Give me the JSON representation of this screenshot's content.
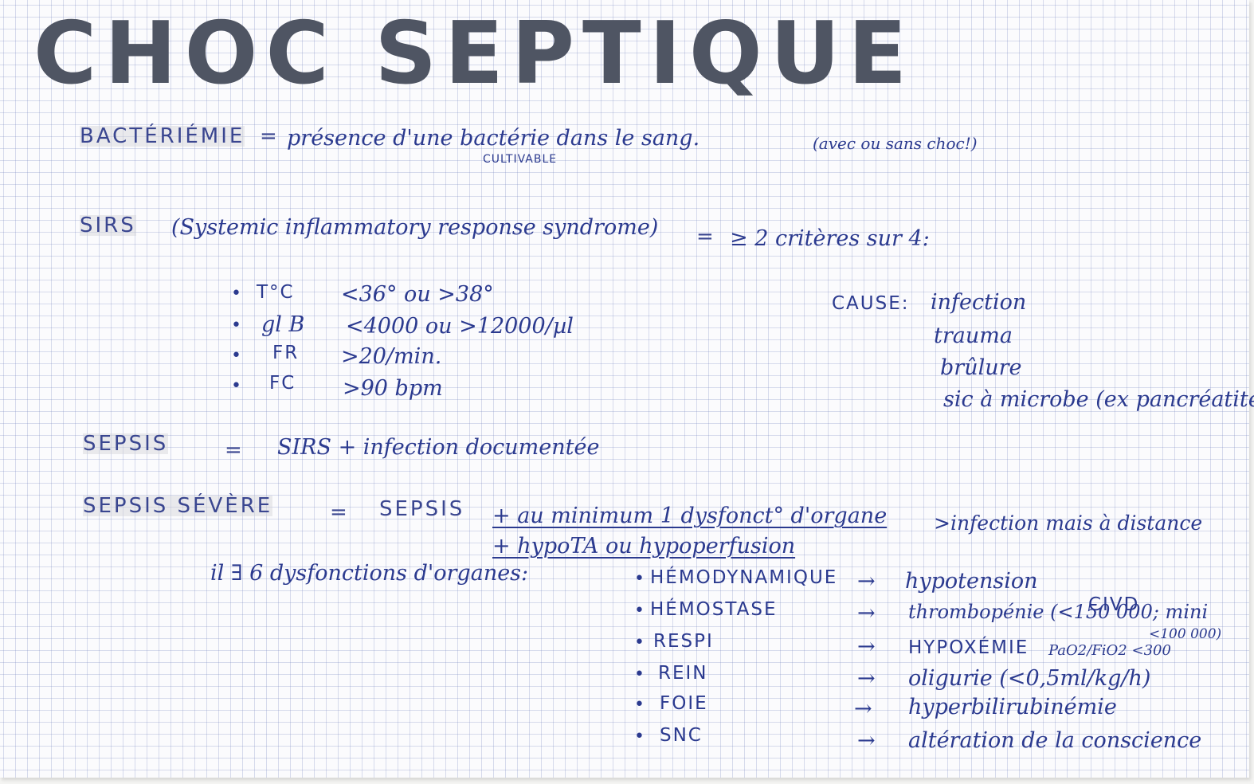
{
  "title": "CHOC SEPTIQUE",
  "bacteriemie": {
    "term": "BACTÉRIÉMIE",
    "eq": "=",
    "def": "présence d'une bactérie dans le sang.",
    "note": "(avec ou sans choc!)",
    "annotation": "CULTIVABLE"
  },
  "sirs": {
    "term": "SIRS",
    "expansion": "(Systemic inflammatory response syndrome)",
    "eq": "=",
    "criteria_intro": "≥ 2 critères sur 4:",
    "criteria": [
      {
        "bullet": "•",
        "name": "T°C",
        "value": "<36°  ou  >38°"
      },
      {
        "bullet": "•",
        "name": "gl B",
        "value": "<4000  ou  >12000/µl"
      },
      {
        "bullet": "•",
        "name": "FR",
        "value": ">20/min."
      },
      {
        "bullet": "•",
        "name": "FC",
        "value": ">90 bpm"
      }
    ],
    "cause_label": "CAUSE:",
    "causes": [
      "infection",
      "trauma",
      "brûlure",
      "sic à microbe (ex pancréatite)"
    ]
  },
  "sepsis": {
    "term": "SEPSIS",
    "eq": "=",
    "def": "SIRS + infection documentée"
  },
  "sepsis_severe": {
    "term": "SEPSIS  SÉVÈRE",
    "eq": "=",
    "base": "SEPSIS",
    "line1": "+ au minimum 1 dysfonct° d'organe",
    "line1_note": ">infection mais à distance",
    "line2": "+ hypoTA ou hypoperfusion"
  },
  "dysfunctions": {
    "intro": "il ∃  6 dysfonctions d'organes:",
    "items": [
      {
        "bullet": "•",
        "organ": "HÉMODYNAMIQUE",
        "arrow": "→",
        "result": "hypotension",
        "extra": ""
      },
      {
        "bullet": "•",
        "organ": "HÉMOSTASE",
        "arrow": "→",
        "result": "thrombopénie (<150 000; mini",
        "extra": "<100 000)"
      },
      {
        "bullet": "•",
        "organ": "RESPI",
        "arrow": "→",
        "result": "HYPOXÉMIE",
        "extra": "PaO2/FiO2 <300"
      },
      {
        "bullet": "•",
        "organ": "REIN",
        "arrow": "→",
        "result": "oligurie (<0,5ml/kg/h)",
        "extra": ""
      },
      {
        "bullet": "•",
        "organ": "FOIE",
        "arrow": "→",
        "result": "hyperbilirubinémie",
        "extra": ""
      },
      {
        "bullet": "•",
        "organ": "SNC",
        "arrow": "→",
        "result": "altération de la conscience",
        "extra": ""
      }
    ],
    "civd": "CIVD"
  }
}
